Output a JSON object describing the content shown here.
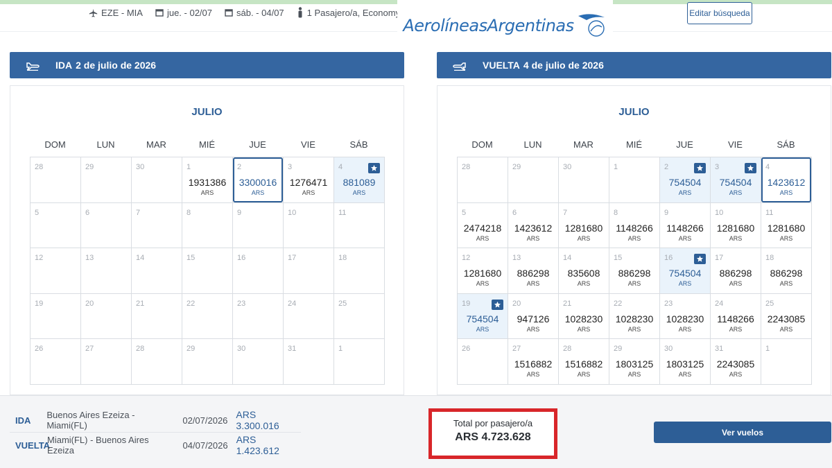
{
  "topbar": {
    "route": "EZE - MIA",
    "departure": "jue. - 02/07",
    "return": "sáb. - 04/07",
    "passengers": "1 Pasajero/a, Economy",
    "edit_label": "Editar búsqueda",
    "logo": "AerolíneasArgentinas"
  },
  "colors": {
    "accent": "#2d5e96",
    "header": "#3566a1",
    "best_bg": "#eaf3fb",
    "highlight": "#d8262a"
  },
  "dow": [
    "DOM",
    "LUN",
    "MAR",
    "MIÉ",
    "JUE",
    "VIE",
    "SÁB"
  ],
  "ida": {
    "label": "IDA",
    "date": "2 de julio de 2026",
    "month": "JULIO",
    "cells": [
      {
        "d": "28",
        "p": ""
      },
      {
        "d": "29",
        "p": ""
      },
      {
        "d": "30",
        "p": ""
      },
      {
        "d": "1",
        "p": "1931386",
        "c": "ARS"
      },
      {
        "d": "2",
        "p": "3300016",
        "c": "ARS",
        "sel": true
      },
      {
        "d": "3",
        "p": "1276471",
        "c": "ARS"
      },
      {
        "d": "4",
        "p": "881089",
        "c": "ARS",
        "best": true
      },
      {
        "d": "5",
        "p": ""
      },
      {
        "d": "6",
        "p": ""
      },
      {
        "d": "7",
        "p": ""
      },
      {
        "d": "8",
        "p": ""
      },
      {
        "d": "9",
        "p": ""
      },
      {
        "d": "10",
        "p": ""
      },
      {
        "d": "11",
        "p": ""
      },
      {
        "d": "12",
        "p": ""
      },
      {
        "d": "13",
        "p": ""
      },
      {
        "d": "14",
        "p": ""
      },
      {
        "d": "15",
        "p": ""
      },
      {
        "d": "16",
        "p": ""
      },
      {
        "d": "17",
        "p": ""
      },
      {
        "d": "18",
        "p": ""
      },
      {
        "d": "19",
        "p": ""
      },
      {
        "d": "20",
        "p": ""
      },
      {
        "d": "21",
        "p": ""
      },
      {
        "d": "22",
        "p": ""
      },
      {
        "d": "23",
        "p": ""
      },
      {
        "d": "24",
        "p": ""
      },
      {
        "d": "25",
        "p": ""
      },
      {
        "d": "26",
        "p": ""
      },
      {
        "d": "27",
        "p": ""
      },
      {
        "d": "28",
        "p": ""
      },
      {
        "d": "29",
        "p": ""
      },
      {
        "d": "30",
        "p": ""
      },
      {
        "d": "31",
        "p": ""
      },
      {
        "d": "1",
        "p": ""
      }
    ]
  },
  "vuelta": {
    "label": "VUELTA",
    "date": "4 de julio de 2026",
    "month": "JULIO",
    "cells": [
      {
        "d": "28",
        "p": ""
      },
      {
        "d": "29",
        "p": ""
      },
      {
        "d": "30",
        "p": ""
      },
      {
        "d": "1",
        "p": ""
      },
      {
        "d": "2",
        "p": "754504",
        "c": "ARS",
        "best": true
      },
      {
        "d": "3",
        "p": "754504",
        "c": "ARS",
        "best": true
      },
      {
        "d": "4",
        "p": "1423612",
        "c": "ARS",
        "sel": true
      },
      {
        "d": "5",
        "p": "2474218",
        "c": "ARS"
      },
      {
        "d": "6",
        "p": "1423612",
        "c": "ARS"
      },
      {
        "d": "7",
        "p": "1281680",
        "c": "ARS"
      },
      {
        "d": "8",
        "p": "1148266",
        "c": "ARS"
      },
      {
        "d": "9",
        "p": "1148266",
        "c": "ARS"
      },
      {
        "d": "10",
        "p": "1281680",
        "c": "ARS"
      },
      {
        "d": "11",
        "p": "1281680",
        "c": "ARS"
      },
      {
        "d": "12",
        "p": "1281680",
        "c": "ARS"
      },
      {
        "d": "13",
        "p": "886298",
        "c": "ARS"
      },
      {
        "d": "14",
        "p": "835608",
        "c": "ARS"
      },
      {
        "d": "15",
        "p": "886298",
        "c": "ARS"
      },
      {
        "d": "16",
        "p": "754504",
        "c": "ARS",
        "best": true
      },
      {
        "d": "17",
        "p": "886298",
        "c": "ARS"
      },
      {
        "d": "18",
        "p": "886298",
        "c": "ARS"
      },
      {
        "d": "19",
        "p": "754504",
        "c": "ARS",
        "best": true
      },
      {
        "d": "20",
        "p": "947126",
        "c": "ARS"
      },
      {
        "d": "21",
        "p": "1028230",
        "c": "ARS"
      },
      {
        "d": "22",
        "p": "1028230",
        "c": "ARS"
      },
      {
        "d": "23",
        "p": "1028230",
        "c": "ARS"
      },
      {
        "d": "24",
        "p": "1148266",
        "c": "ARS"
      },
      {
        "d": "25",
        "p": "2243085",
        "c": "ARS"
      },
      {
        "d": "26",
        "p": ""
      },
      {
        "d": "27",
        "p": "1516882",
        "c": "ARS"
      },
      {
        "d": "28",
        "p": "1516882",
        "c": "ARS"
      },
      {
        "d": "29",
        "p": "1803125",
        "c": "ARS"
      },
      {
        "d": "30",
        "p": "1803125",
        "c": "ARS"
      },
      {
        "d": "31",
        "p": "2243085",
        "c": "ARS"
      },
      {
        "d": "1",
        "p": ""
      }
    ]
  },
  "footer": {
    "ida": {
      "label": "IDA",
      "route": "Buenos Aires Ezeiza - Miami(FL)",
      "date": "02/07/2026",
      "amount": "ARS 3.300.016"
    },
    "vuelta": {
      "label": "VUELTA",
      "route": "Miami(FL) - Buenos Aires Ezeiza",
      "date": "04/07/2026",
      "amount": "ARS 1.423.612"
    },
    "total_label": "Total por pasajero/a",
    "total_value": "ARS 4.723.628",
    "cta": "Ver vuelos"
  }
}
